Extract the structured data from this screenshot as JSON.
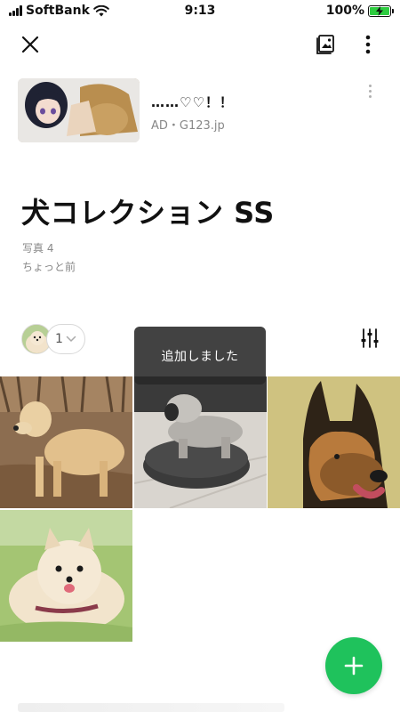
{
  "status_bar": {
    "carrier": "SoftBank",
    "time": "9:13",
    "battery": "100%",
    "battery_level": 1.0
  },
  "top_bar": {
    "close_icon": "close-icon",
    "image_icon": "image-frame-icon",
    "more_icon": "vertical-ellipsis-icon"
  },
  "ad": {
    "title": "……♡♡！！",
    "subtitle": "AD・G123.jp"
  },
  "album": {
    "title": "犬コレクション SS",
    "photo_count": "写真 4",
    "updated": "ちょっと前"
  },
  "members": {
    "count": "1"
  },
  "toast": {
    "message": "追加しました"
  },
  "photos": [
    {
      "subject": "golden-retriever"
    },
    {
      "subject": "aibo-robot-dog"
    },
    {
      "subject": "german-shepherd"
    },
    {
      "subject": "pomeranian"
    }
  ],
  "fab": {
    "icon": "plus-icon"
  },
  "colors": {
    "accent": "#1fc25c",
    "toast_bg": "#282828",
    "muted_text": "#888888"
  }
}
